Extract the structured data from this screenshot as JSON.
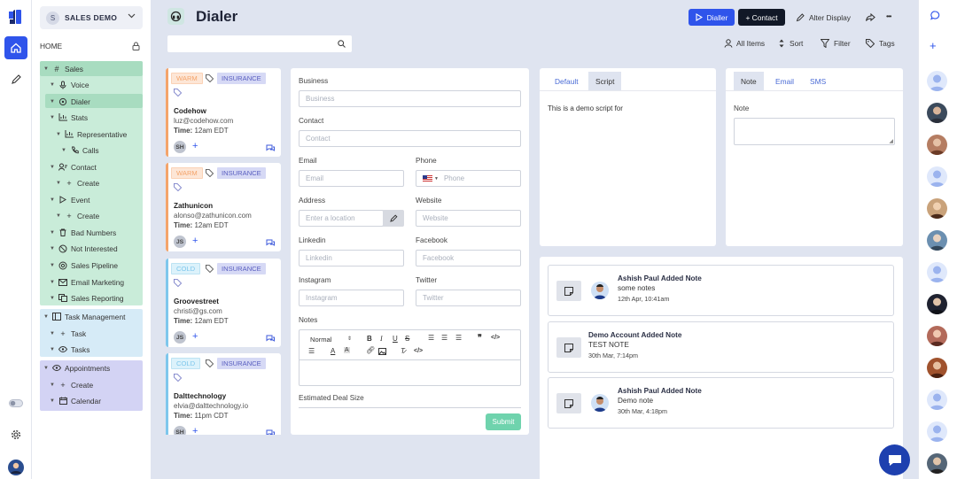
{
  "left_rail": {
    "icons": [
      "logo-icon",
      "home-icon",
      "pencil-icon",
      "toggle-icon",
      "gear-icon",
      "user-avatar"
    ]
  },
  "sidebar": {
    "workspace_initial": "S",
    "workspace_name": "SALES DEMO",
    "home_label": "HOME",
    "items": {
      "sales": "Sales",
      "voice": "Voice",
      "dialer": "Dialer",
      "stats": "Stats",
      "representative": "Representative",
      "calls": "Calls",
      "contact": "Contact",
      "contact_create": "Create",
      "event": "Event",
      "event_create": "Create",
      "bad_numbers": "Bad Numbers",
      "not_interested": "Not Interested",
      "sales_pipeline": "Sales Pipeline",
      "email_marketing": "Email Marketing",
      "sales_reporting": "Sales Reporting",
      "task_management": "Task Management",
      "task": "Task",
      "tasks": "Tasks",
      "appointments": "Appointments",
      "appt_create": "Create",
      "calendar": "Calendar"
    }
  },
  "header": {
    "title": "Dialer",
    "dialler_button": "Dialler",
    "contact_button": "+ Contact",
    "alter_display": "Alter Display",
    "more": "•••"
  },
  "toolbar": {
    "search_placeholder": "",
    "all_items": "All Items",
    "sort": "Sort",
    "filter": "Filter",
    "tags": "Tags"
  },
  "contacts": [
    {
      "status": "WARM",
      "category": "INSURANCE",
      "company": "Codehow",
      "email": "luz@codehow.com",
      "time_label": "Time:",
      "time": "12am EDT",
      "initials": "SH"
    },
    {
      "status": "WARM",
      "category": "INSURANCE",
      "company": "Zathunicon",
      "email": "alonso@zathunicon.com",
      "time_label": "Time:",
      "time": "12am EDT",
      "initials": "JS"
    },
    {
      "status": "COLD",
      "category": "INSURANCE",
      "company": "Groovestreet",
      "email": "christi@gs.com",
      "time_label": "Time:",
      "time": "12am EDT",
      "initials": "JS"
    },
    {
      "status": "COLD",
      "category": "INSURANCE",
      "company": "Dalttechnology",
      "email": "elvia@dalttechnology.io",
      "time_label": "Time:",
      "time": "11pm CDT",
      "initials": "SH"
    }
  ],
  "form": {
    "business_label": "Business",
    "business_placeholder": "Business",
    "contact_label": "Contact",
    "contact_placeholder": "Contact",
    "email_label": "Email",
    "email_placeholder": "Email",
    "phone_label": "Phone",
    "phone_placeholder": "Phone",
    "address_label": "Address",
    "address_placeholder": "Enter a location",
    "website_label": "Website",
    "website_placeholder": "Website",
    "linkedin_label": "Linkedin",
    "linkedin_placeholder": "Linkedin",
    "facebook_label": "Facebook",
    "facebook_placeholder": "Facebook",
    "instagram_label": "Instagram",
    "instagram_placeholder": "Instagram",
    "twitter_label": "Twitter",
    "twitter_placeholder": "Twitter",
    "notes_label": "Notes",
    "editor_format": "Normal",
    "deal_size_label": "Estimated Deal Size",
    "submit": "Submit"
  },
  "script_panel": {
    "tab_default": "Default",
    "tab_script": "Script",
    "text": "This is a demo script for"
  },
  "note_panel": {
    "tab_note": "Note",
    "tab_email": "Email",
    "tab_sms": "SMS",
    "note_label": "Note"
  },
  "activity": [
    {
      "title": "Ashish Paul Added Note",
      "body": "some notes",
      "date": "12th Apr, 10:41am",
      "has_avatar": true
    },
    {
      "title": "Demo Account Added Note",
      "body": "TEST NOTE",
      "date": "30th Mar, 7:14pm",
      "has_avatar": false
    },
    {
      "title": "Ashish Paul Added Note",
      "body": "Demo note",
      "date": "30th Mar, 4:18pm",
      "has_avatar": true
    }
  ],
  "colors": {
    "accent": "#2f54eb",
    "warm": "#f4a46b",
    "cold": "#7ec7ec",
    "sales_bg": "#c9ecd9",
    "task_bg": "#d6ebf7",
    "appt_bg": "#d3d3f4",
    "submit": "#6fd3ad"
  }
}
